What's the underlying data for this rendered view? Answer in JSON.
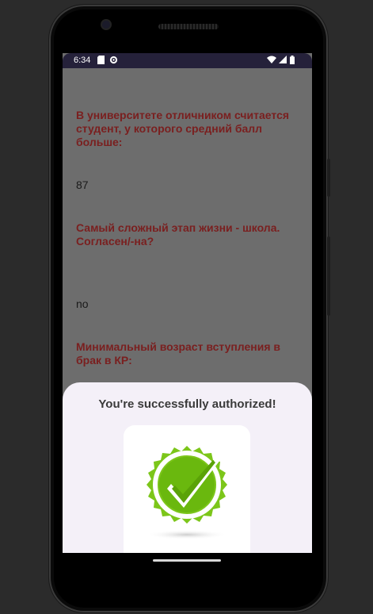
{
  "status_bar": {
    "time": "6:34",
    "left_icons": [
      "sd-card-icon",
      "settings-gear-icon"
    ],
    "right_icons": [
      "wifi-icon",
      "signal-icon",
      "battery-icon"
    ]
  },
  "questions": [
    {
      "question": "В университете отличником считается студент, у которого средний балл больше:",
      "answer": "87"
    },
    {
      "question": "Самый сложный этап жизни - школа. Согласен/-на?",
      "answer": "no"
    },
    {
      "question": "Минимальный возраст вступления в брак в КР:",
      "answer": ""
    }
  ],
  "dialog": {
    "title": "You're successfully authorized!",
    "badge_icon": "verified-check-badge-icon"
  },
  "colors": {
    "question_text": "#7a1f1f",
    "status_bar": "#25213a",
    "sheet_background": "#f4f0f8",
    "badge_green": "#7cc61a"
  }
}
